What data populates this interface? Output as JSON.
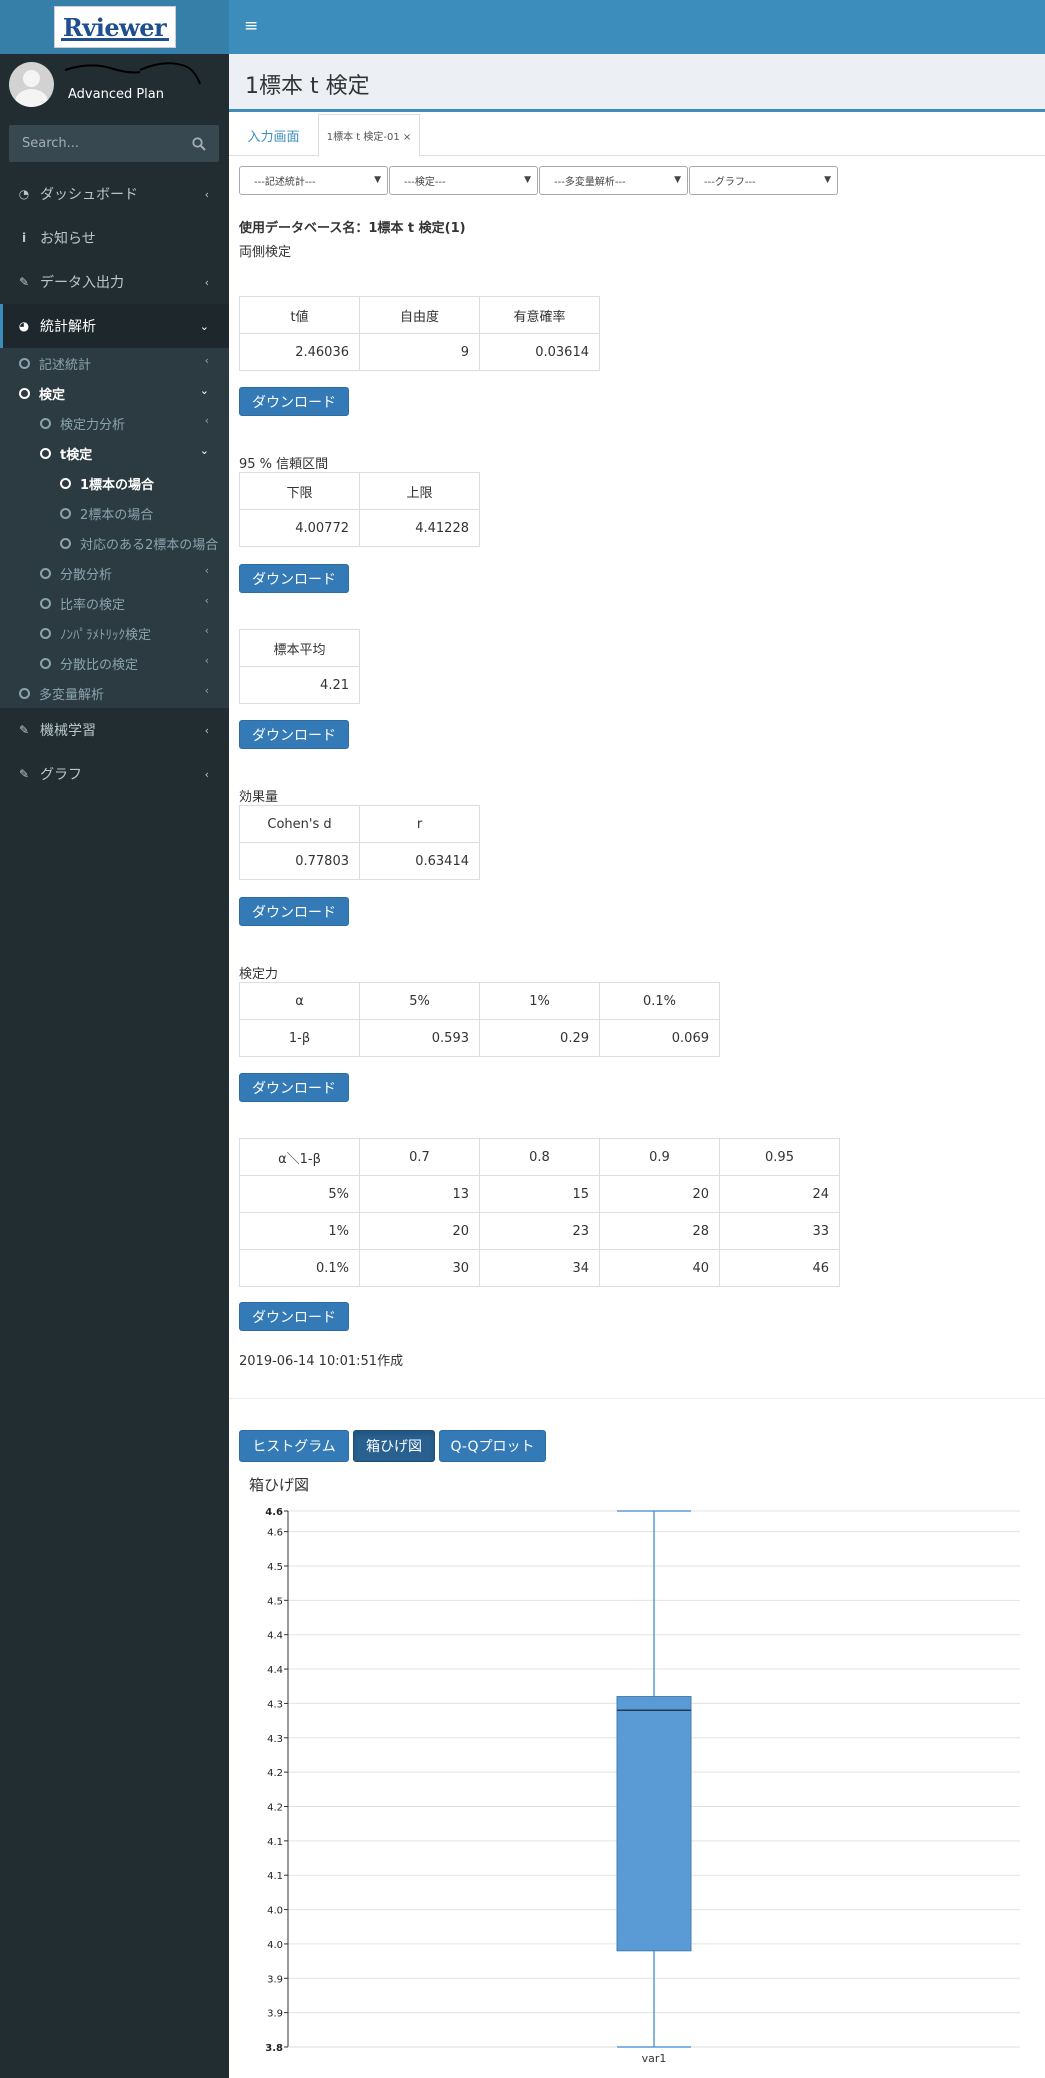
{
  "sidebar": {
    "logo_text": "Rviewer",
    "plan": "Advanced Plan",
    "search_placeholder": "Search...",
    "items": [
      {
        "icon": "dashboard-icon",
        "label": "ダッシュボード"
      },
      {
        "icon": "info-icon",
        "label": "お知らせ"
      },
      {
        "icon": "edit-icon",
        "label": "データ入出力"
      },
      {
        "icon": "pie-chart-icon",
        "label": "統計解析"
      },
      {
        "icon": "edit-icon",
        "label": "機械学習"
      },
      {
        "icon": "edit-icon",
        "label": "グラフ"
      }
    ],
    "sub": {
      "descriptive": "記述統計",
      "test": "検定",
      "power": "検定力分析",
      "ttest": "t検定",
      "one_sample": "1標本の場合",
      "two_sample": "2標本の場合",
      "paired": "対応のある2標本の場合",
      "anova": "分散分析",
      "ratio": "比率の検定",
      "nonparam": "ﾉﾝﾊﾟﾗﾒﾄﾘｯｸ検定",
      "var_ratio": "分散比の検定",
      "multivariate": "多変量解析"
    }
  },
  "header": {
    "menu_icon": "≡",
    "title": "1標本 t 検定"
  },
  "tabs": [
    {
      "label": "入力画面"
    },
    {
      "label": "1標本 t 検定-01 ×"
    }
  ],
  "selects": [
    "---記述統計---",
    "---検定---",
    "---多変量解析---",
    "---グラフ---"
  ],
  "result": {
    "db_name": "使用データベース名：1標本 t 検定(1)",
    "test_type": "両側検定",
    "download_label": "ダウンロード",
    "t_table": {
      "headers": [
        "t値",
        "自由度",
        "有意確率"
      ],
      "values": [
        "2.46036",
        "9",
        "0.03614"
      ]
    },
    "ci_label": "95 % 信頼区間",
    "ci_table": {
      "headers": [
        "下限",
        "上限"
      ],
      "values": [
        "4.00772",
        "4.41228"
      ]
    },
    "mean_table": {
      "headers": [
        "標本平均"
      ],
      "values": [
        "4.21"
      ]
    },
    "effect_label": "効果量",
    "effect_table": {
      "headers": [
        "Cohen's d",
        "r"
      ],
      "values": [
        "0.77803",
        "0.63414"
      ]
    },
    "power_label": "検定力",
    "power_table": {
      "headers": [
        "α",
        "5%",
        "1%",
        "0.1%"
      ],
      "values": [
        "1-β",
        "0.593",
        "0.29",
        "0.069"
      ]
    },
    "n_table": {
      "headers": [
        "α＼1-β",
        "0.7",
        "0.8",
        "0.9",
        "0.95"
      ],
      "rows": [
        [
          "5%",
          "13",
          "15",
          "20",
          "24"
        ],
        [
          "1%",
          "20",
          "23",
          "28",
          "33"
        ],
        [
          "0.1%",
          "30",
          "34",
          "40",
          "46"
        ]
      ]
    },
    "created": "2019-06-14 10:01:51作成"
  },
  "graph_buttons": [
    "ヒストグラム",
    "箱ひげ図",
    "Q-Qプロット"
  ],
  "chart_data": {
    "type": "box",
    "title": "箱ひげ図",
    "categories": [
      "var1"
    ],
    "box": {
      "min": 3.82,
      "q1": 3.96,
      "median": 4.31,
      "q3": 4.33,
      "max": 4.6
    },
    "ylim": [
      3.82,
      4.6
    ],
    "yticks": [
      3.82,
      3.87,
      3.92,
      3.97,
      4.02,
      4.07,
      4.12,
      4.17,
      4.22,
      4.27,
      4.32,
      4.37,
      4.42,
      4.47,
      4.52,
      4.57,
      4.6
    ],
    "ytick_labels": [
      "3.8",
      "3.9",
      "3.9",
      "4.0",
      "4.0",
      "4.1",
      "4.1",
      "4.2",
      "4.2",
      "4.3",
      "4.3",
      "4.4",
      "4.4",
      "4.5",
      "4.5",
      "4.6",
      "4.6"
    ],
    "box_color": "#5b9bd5",
    "grid": true
  }
}
